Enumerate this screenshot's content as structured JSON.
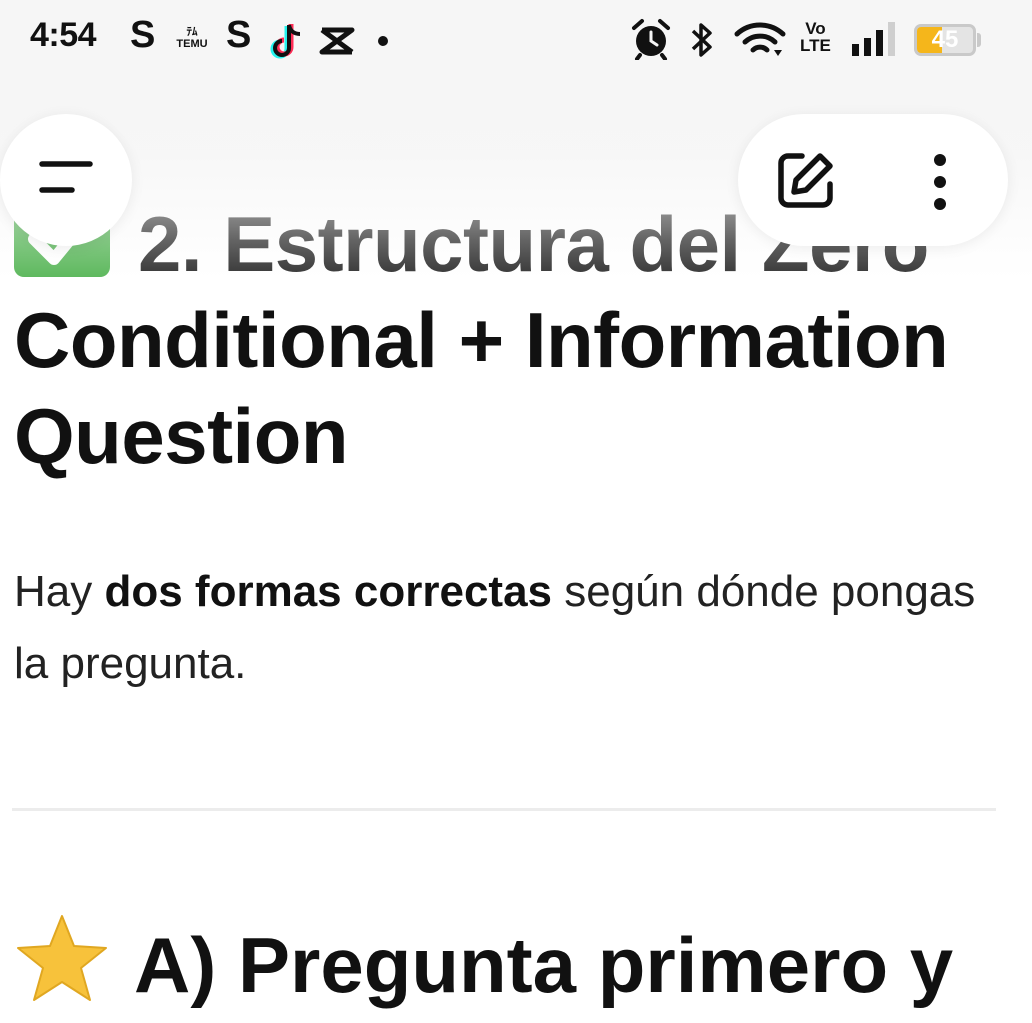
{
  "status_bar": {
    "time": "4:54",
    "s_app_1": "S",
    "temu_line1": "ﾃﾑ",
    "temu_line2": "TEMU",
    "s_app_2": "S",
    "volte_top": "Vo",
    "volte_bottom": "LTE",
    "battery_percent": "45",
    "battery_level": 0.45,
    "battery_color": "#f5b61b"
  },
  "article": {
    "heading_line1": "2. Estructura del Zero",
    "heading_rest": "Conditional + Information Question",
    "paragraph": {
      "before": "Hay ",
      "bold": "dos formas correctas",
      "after": " según dónde pongas la pregunta."
    },
    "subheading": "A) Pregunta primero y"
  },
  "icons": {
    "heading_emoji": "check-mark-button-icon",
    "subheading_emoji": "star-icon",
    "menu": "hamburger-menu-icon",
    "edit": "edit-icon",
    "more": "more-vertical-icon"
  },
  "colors": {
    "check_green": "#5cb85c",
    "star_gold": "#f7c23b",
    "text": "#111111"
  }
}
